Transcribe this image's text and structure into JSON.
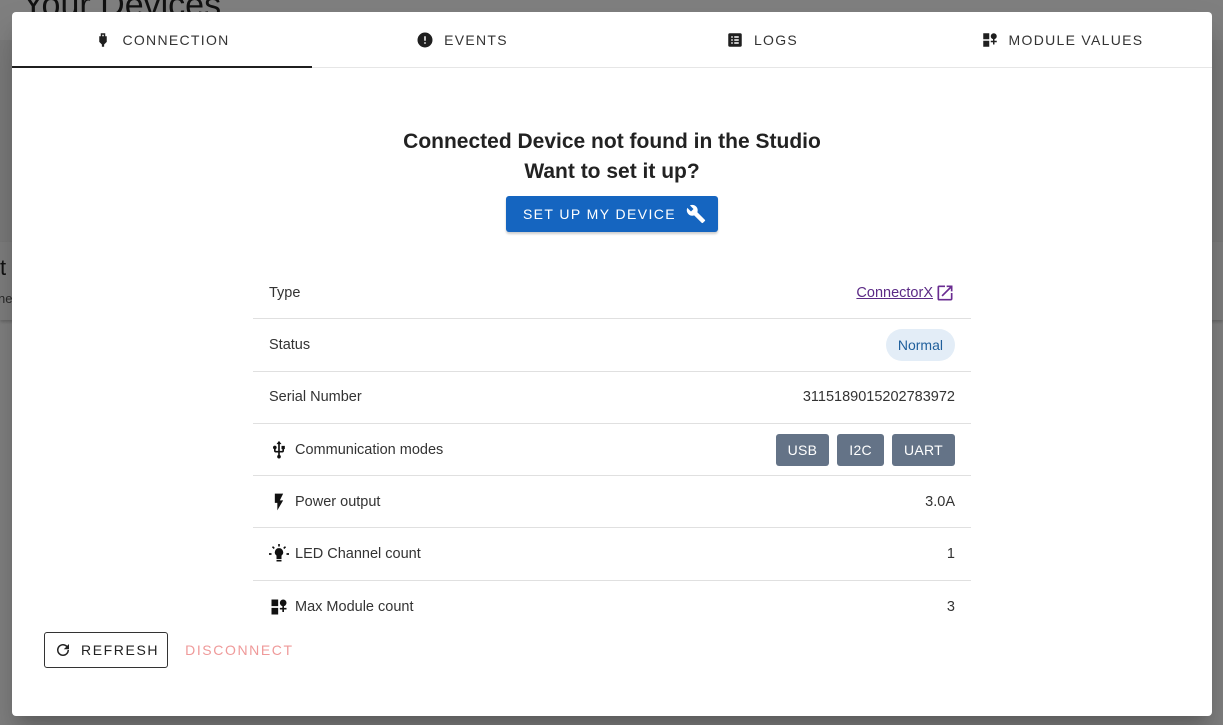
{
  "background": {
    "title": "Your Devices",
    "fragment_t": "t",
    "fragment_ne": "ne"
  },
  "tabs": [
    {
      "label": "Connection",
      "icon": "usb-plug-icon",
      "active": true
    },
    {
      "label": "Events",
      "icon": "alert-circle-icon",
      "active": false
    },
    {
      "label": "Logs",
      "icon": "list-icon",
      "active": false
    },
    {
      "label": "Module Values",
      "icon": "widgets-icon",
      "active": false
    }
  ],
  "notice": {
    "line1": "Connected Device not found in the Studio",
    "line2": "Want to set it up?",
    "setup_button": "Set up my device"
  },
  "device": {
    "type_label": "Type",
    "type_value": "ConnectorX",
    "status_label": "Status",
    "status_value": "Normal",
    "serial_label": "Serial Number",
    "serial_value": "3115189015202783972",
    "comm_label": "Communication modes",
    "comm_modes": [
      "USB",
      "I2C",
      "UART"
    ],
    "power_label": "Power output",
    "power_value": "3.0A",
    "led_label": "LED Channel count",
    "led_value": "1",
    "module_label": "Max Module count",
    "module_value": "3"
  },
  "footer": {
    "refresh": "Refresh",
    "disconnect": "Disconnect"
  },
  "colors": {
    "primary": "#1565c0",
    "chip": "#647387",
    "status_bg": "#e3edf7",
    "disconnect": "#ef9a9a",
    "link": "#5b2a86"
  }
}
